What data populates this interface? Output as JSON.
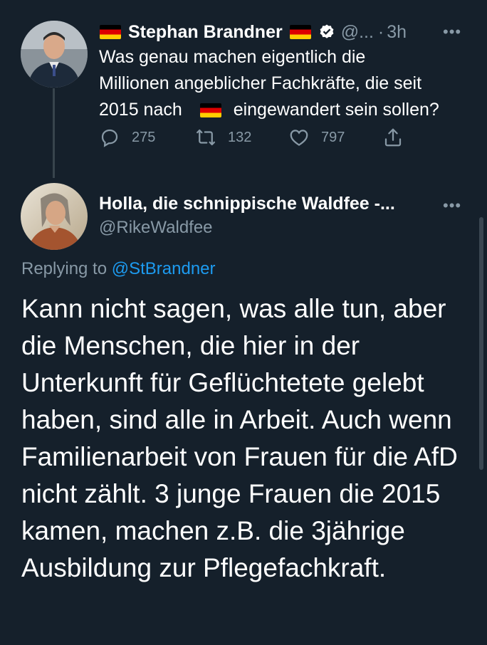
{
  "parent_tweet": {
    "author_name": "Stephan Brandner",
    "handle": "@...",
    "separator": "·",
    "time": "3h",
    "text_line1": "Was genau machen eigentlich die",
    "text_line2": "Millionen angeblicher Fachkräfte, die seit",
    "text_line3_before": "2015 nach",
    "text_line3_after": "eingewandert sein sollen?",
    "reply_count": "275",
    "retweet_count": "132",
    "like_count": "797"
  },
  "reply_tweet": {
    "author_name": "Holla, die schnippische Waldfee -...",
    "handle": "@RikeWaldfee",
    "replying_to_label": "Replying to",
    "replying_to_handle": "@StBrandner",
    "text": "Kann nicht sagen, was alle tun, aber die Menschen, die hier in der Unterkunft für Geflüchtetete gelebt haben, sind alle in Arbeit. Auch wenn  Familienarbeit von Frauen für die AfD nicht zählt. 3 junge Frauen die 2015 kamen, machen z.B. die 3jährige Ausbildung zur Pflegefachkraft."
  },
  "icons": {
    "flag": "german-flag-icon",
    "verified": "verified-badge-icon",
    "more": "more-icon",
    "reply": "reply-icon",
    "retweet": "retweet-icon",
    "like": "heart-icon",
    "share": "share-icon"
  },
  "more_label": "•••",
  "colors": {
    "background": "#15202b",
    "secondary_text": "#8899a6",
    "link": "#1d9bf0",
    "thread_line": "#38444d"
  }
}
